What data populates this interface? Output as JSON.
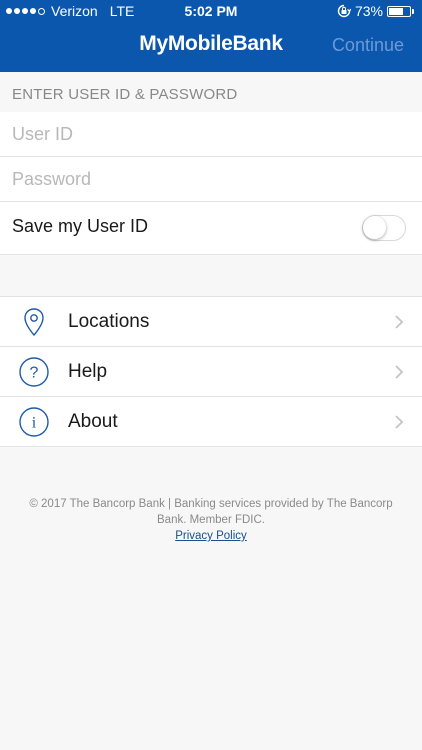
{
  "status_bar": {
    "carrier": "Verizon",
    "network": "LTE",
    "time": "5:02 PM",
    "battery": "73%",
    "battery_level": 0.73,
    "signal_bars": 4
  },
  "nav": {
    "title": "MyMobileBank",
    "continue_label": "Continue"
  },
  "login": {
    "section_header": "ENTER USER ID & PASSWORD",
    "user_id_placeholder": "User ID",
    "password_placeholder": "Password",
    "save_user_id_label": "Save my User ID",
    "save_user_id_on": false
  },
  "menu": {
    "items": [
      {
        "label": "Locations",
        "icon": "location-pin-icon"
      },
      {
        "label": "Help",
        "icon": "question-icon"
      },
      {
        "label": "About",
        "icon": "info-icon"
      }
    ]
  },
  "footer": {
    "text": "© 2017 The Bancorp Bank | Banking services provided by The Bancorp Bank. Member FDIC.",
    "privacy_link": "Privacy Policy"
  },
  "colors": {
    "brand": "#0a57ad",
    "icon_stroke": "#1f5ba8",
    "continue_disabled": "#6c9ad6",
    "background": "#f7f7f7"
  }
}
